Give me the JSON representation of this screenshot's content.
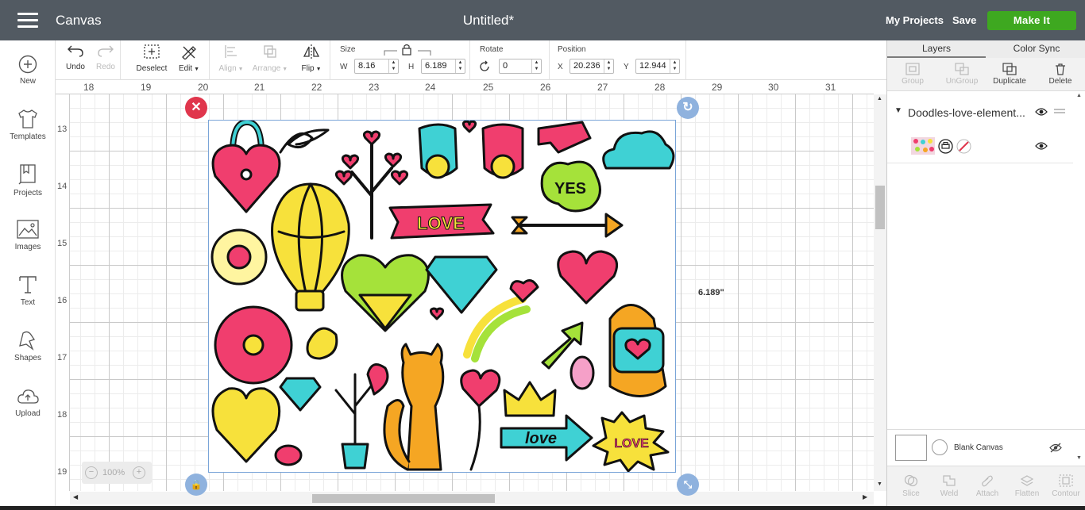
{
  "topbar": {
    "app_title": "Canvas",
    "doc_title": "Untitled*",
    "my_projects": "My Projects",
    "save": "Save",
    "make_it": "Make It"
  },
  "leftbar": {
    "items": [
      {
        "label": "New",
        "icon": "plus-circle-icon"
      },
      {
        "label": "Templates",
        "icon": "tshirt-icon"
      },
      {
        "label": "Projects",
        "icon": "projects-icon"
      },
      {
        "label": "Images",
        "icon": "image-icon"
      },
      {
        "label": "Text",
        "icon": "text-icon"
      },
      {
        "label": "Shapes",
        "icon": "shapes-icon"
      },
      {
        "label": "Upload",
        "icon": "upload-cloud-icon"
      }
    ]
  },
  "toolbar": {
    "undo": "Undo",
    "redo": "Redo",
    "deselect": "Deselect",
    "edit": "Edit",
    "align": "Align",
    "arrange": "Arrange",
    "flip": "Flip",
    "size_caption": "Size",
    "w_label": "W",
    "w_value": "8.16",
    "h_label": "H",
    "h_value": "6.189",
    "rotate_caption": "Rotate",
    "rotate_value": "0",
    "position_caption": "Position",
    "x_label": "X",
    "x_value": "20.236",
    "y_label": "Y",
    "y_value": "12.944"
  },
  "canvas": {
    "ruler_top": [
      "18",
      "19",
      "20",
      "21",
      "22",
      "23",
      "24",
      "25",
      "26",
      "27",
      "28",
      "29",
      "30",
      "31"
    ],
    "ruler_left": [
      "13",
      "14",
      "15",
      "16",
      "17",
      "18",
      "19"
    ],
    "height_label": "6.189\"",
    "zoom": "100%",
    "zoom_minus": "−",
    "zoom_plus": "+",
    "art_words": {
      "love_banner": "LOVE",
      "yes": "YES",
      "love_arrow": "love",
      "love_burst": "LOVE"
    }
  },
  "rightpanel": {
    "tabs": [
      "Layers",
      "Color Sync"
    ],
    "actions": [
      "Group",
      "UnGroup",
      "Duplicate",
      "Delete"
    ],
    "layer_group_name": "Doodles-love-element...",
    "blank_canvas": "Blank Canvas",
    "bottom_actions": [
      "Slice",
      "Weld",
      "Attach",
      "Flatten",
      "Contour"
    ]
  },
  "colors": {
    "topbar": "#525a62",
    "make_it": "#3ea820",
    "selection": "#7aa5d8",
    "delete_handle": "#e0364c",
    "rotate_handle": "#8fb2de"
  }
}
